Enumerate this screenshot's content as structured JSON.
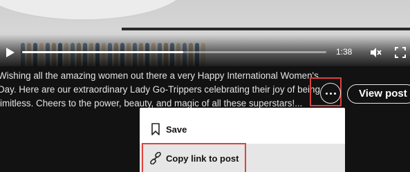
{
  "video": {
    "time": "1:38",
    "progress_fraction": 0.53,
    "icons": {
      "play": "play-icon",
      "mute": "volume-muted-icon",
      "fullscreen": "fullscreen-icon"
    }
  },
  "caption": {
    "line1": "Wishing all the amazing women out there a very Happy International Women's",
    "line2": "Day. Here are our extraordinary Lady Go-Trippers celebrating their joy of being",
    "line3": "limitless. Cheers to the power, beauty, and magic of all these superstars!..."
  },
  "actions": {
    "more_icon": "more-horizontal-icon",
    "view_post_label": "View post"
  },
  "menu": {
    "items": [
      {
        "label": "Save",
        "icon": "bookmark-icon"
      },
      {
        "label": "Copy link to post",
        "icon": "link-icon"
      }
    ]
  },
  "colors": {
    "background": "#121212",
    "highlight": "#e04040",
    "menu_bg": "#ffffff",
    "menu_hover": "#e6e6e6"
  }
}
